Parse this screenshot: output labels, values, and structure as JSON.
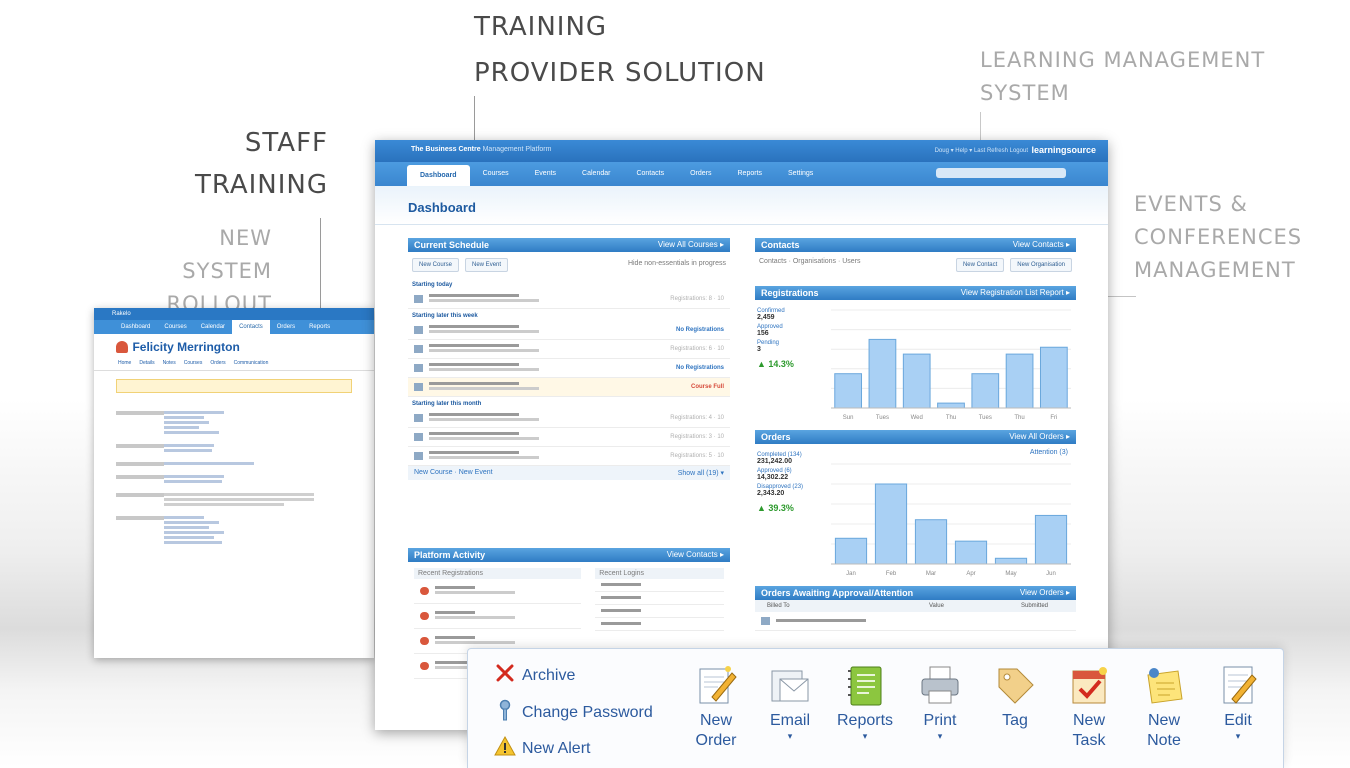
{
  "labels": {
    "training_provider": [
      "TRAINING",
      "PROVIDER SOLUTION"
    ],
    "lms": [
      "LEARNING MANAGEMENT",
      "SYSTEM"
    ],
    "staff_training": [
      "STAFF",
      "TRAINING"
    ],
    "new_system": [
      "NEW SYSTEM",
      "ROLLOUT"
    ],
    "events": [
      "EVENTS &",
      "CONFERENCES",
      "MANAGEMENT"
    ]
  },
  "left_screen": {
    "app": "Rakelo",
    "tabs": [
      "Dashboard",
      "Courses",
      "Calendar",
      "Contacts",
      "Orders",
      "Reports"
    ],
    "person_name": "Felicity Merrington"
  },
  "main_screen": {
    "app_title": "The Business Centre",
    "app_subtitle": "Management Platform",
    "top_links": "Doug ▾   Help ▾   Last Refresh   Logout",
    "logo": "learningsource",
    "nav": [
      "Dashboard",
      "Courses",
      "Events",
      "Calendar",
      "Contacts",
      "Orders",
      "Reports",
      "Settings"
    ],
    "page_title": "Dashboard",
    "current_schedule": {
      "title": "Current Schedule",
      "link": "View All Courses ▸",
      "new_course": "New Course",
      "new_event": "New Event",
      "hide_note": "Hide non-essentials in progress",
      "groups": [
        "Starting today",
        "Starting later this week",
        "Starting later this month"
      ],
      "status": {
        "no_reg": "No Registrations",
        "cancel": "Course Full"
      },
      "footer_left": "New Course · New Event",
      "footer_right": "Show all (19) ▾"
    },
    "platform_activity": {
      "title": "Platform Activity",
      "link": "View Contacts ▸",
      "recent_reg": "Recent Registrations",
      "recent_logins": "Recent Logins"
    },
    "contacts": {
      "title": "Contacts",
      "link": "View Contacts ▸",
      "new_contact": "New Contact",
      "new_org": "New Organisation"
    },
    "registrations": {
      "title": "Registrations",
      "link": "View Registration List Report ▸",
      "confirmed_label": "Confirmed",
      "confirmed": "2,459",
      "approved_label": "Approved",
      "approved": "156",
      "pending_label": "Pending",
      "pending": "3",
      "pct": "▲ 14.3%"
    },
    "orders": {
      "title": "Orders",
      "link": "View All Orders ▸",
      "completed_label": "Completed (134)",
      "completed": "231,242.00",
      "approved_label": "Approved (6)",
      "approved": "14,302.22",
      "unapproved_label": "Disapproved (23)",
      "unapproved": "2,343.20",
      "pct": "▲ 39.3%",
      "attention": "Attention (3)"
    },
    "awaiting": {
      "title": "Orders Awaiting Approval/Attention",
      "link": "View Orders ▸",
      "cols": [
        "Billed To",
        "Value",
        "Submitted"
      ]
    }
  },
  "chart_data": [
    {
      "type": "bar",
      "title": "Registrations",
      "categories": [
        "Sun",
        "Tues",
        "Wed",
        "Thu",
        "Tues",
        "Thu",
        "Fri"
      ],
      "values": [
        3.5,
        7,
        5.5,
        0.5,
        3.5,
        5.5,
        6.2
      ],
      "ylim": [
        0,
        10
      ]
    },
    {
      "type": "bar",
      "title": "Orders",
      "categories": [
        "Jan",
        "Feb",
        "Mar",
        "Apr",
        "May",
        "Jun"
      ],
      "values": [
        1800,
        5600,
        3100,
        1600,
        400,
        3400
      ],
      "ylim": [
        0,
        7000
      ]
    }
  ],
  "toolbar": {
    "archive": "Archive",
    "change_password": "Change Password",
    "new_alert": "New Alert",
    "buttons": [
      {
        "label1": "New",
        "label2": "Order",
        "icon": "new-order-icon"
      },
      {
        "label1": "Email",
        "label2": "",
        "icon": "email-icon",
        "caret": "▾"
      },
      {
        "label1": "Reports",
        "label2": "",
        "icon": "reports-icon",
        "caret": "▾"
      },
      {
        "label1": "Print",
        "label2": "",
        "icon": "print-icon",
        "caret": "▾"
      },
      {
        "label1": "Tag",
        "label2": "",
        "icon": "tag-icon"
      },
      {
        "label1": "New",
        "label2": "Task",
        "icon": "new-task-icon"
      },
      {
        "label1": "New",
        "label2": "Note",
        "icon": "new-note-icon"
      },
      {
        "label1": "Edit",
        "label2": "",
        "icon": "edit-icon",
        "caret": "▾"
      }
    ]
  }
}
